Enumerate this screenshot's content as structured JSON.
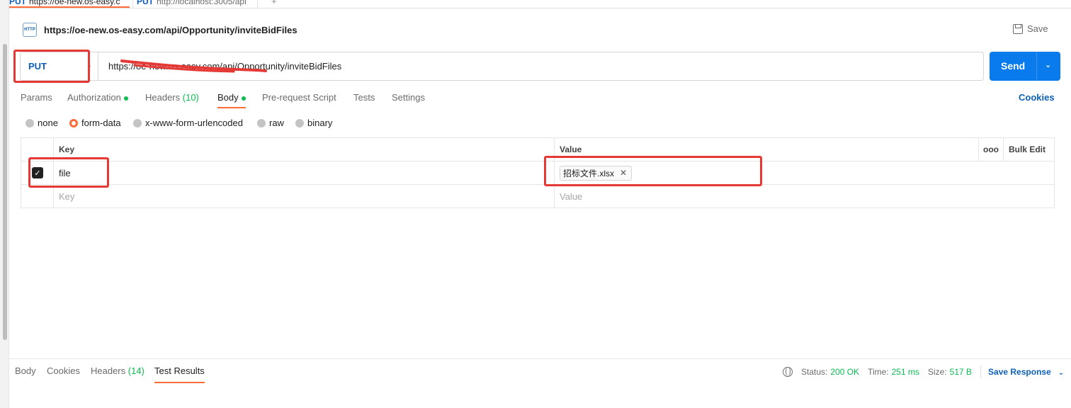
{
  "tabs": [
    {
      "method": "PUT",
      "title": "https://oe-new.os-easy.c"
    },
    {
      "method": "PUT",
      "title": "http://localhost:3005/api"
    }
  ],
  "request": {
    "title": "https://oe-new.os-easy.com/api/Opportunity/inviteBidFiles",
    "save_label": "Save",
    "method": "PUT",
    "url": "https://oe-new.os-easy.com/api/Opportunity/inviteBidFiles",
    "send_label": "Send",
    "icon_text": "HTTP"
  },
  "request_tabs": {
    "params": "Params",
    "authorization": "Authorization",
    "headers": "Headers",
    "headers_count": "(10)",
    "body": "Body",
    "prerequest": "Pre-request Script",
    "tests": "Tests",
    "settings": "Settings",
    "cookies": "Cookies"
  },
  "body_types": {
    "none": "none",
    "form_data": "form-data",
    "urlencoded": "x-www-form-urlencoded",
    "raw": "raw",
    "binary": "binary",
    "selected": "form-data"
  },
  "kv_table": {
    "key_header": "Key",
    "value_header": "Value",
    "more_icon": "ooo",
    "bulk_edit": "Bulk Edit",
    "rows": [
      {
        "checked": true,
        "key": "file",
        "value_file": "招标文件.xlsx"
      }
    ],
    "key_placeholder": "Key",
    "value_placeholder": "Value"
  },
  "response": {
    "tabs": {
      "body": "Body",
      "cookies": "Cookies",
      "headers": "Headers",
      "headers_count": "(14)",
      "test_results": "Test Results"
    },
    "status_label": "Status:",
    "status_value": "200 OK",
    "time_label": "Time:",
    "time_value": "251 ms",
    "size_label": "Size:",
    "size_value": "517 B",
    "save_response": "Save Response"
  },
  "colors": {
    "accent": "#ff6c37",
    "primary": "#097bed",
    "method": "#0d5fb8",
    "success": "#0cbb52",
    "annotation": "#e53935"
  }
}
